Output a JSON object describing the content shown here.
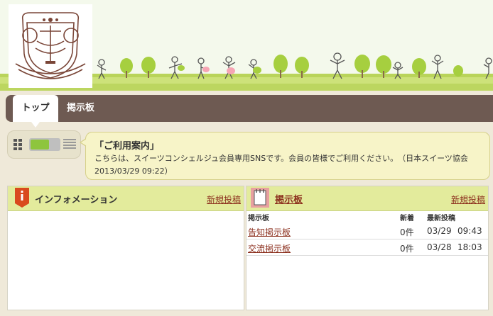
{
  "nav": {
    "top": "トップ",
    "board": "掲示板"
  },
  "notice": {
    "title": "「ご利用案内」",
    "body": "こちらは、スイーツコンシェルジュ会員専用SNSです。会員の皆様でご利用ください。　（日本スイーツ協会 2013/03/29 09:22）"
  },
  "info_panel": {
    "title": "インフォメーション",
    "new_post": "新規投稿"
  },
  "board_panel": {
    "title": "掲示板",
    "new_post": "新規投稿",
    "columns": {
      "name": "掲示板",
      "new": "新着",
      "latest": "最新投稿"
    },
    "rows": [
      {
        "name": "告知掲示板",
        "count": "0件",
        "date": "03/29",
        "time": "09:43"
      },
      {
        "name": "交流掲示板",
        "count": "0件",
        "date": "03/28",
        "time": "18:03"
      }
    ]
  },
  "colors": {
    "nav": "#6e5a52",
    "accent_green": "#8ec53d",
    "link": "#8b2e1c",
    "panel_header": "#e3eb9c"
  },
  "icons": {
    "info": "info-icon",
    "board": "memo-icon",
    "grid": "grid-view-icon",
    "list": "list-view-icon"
  }
}
